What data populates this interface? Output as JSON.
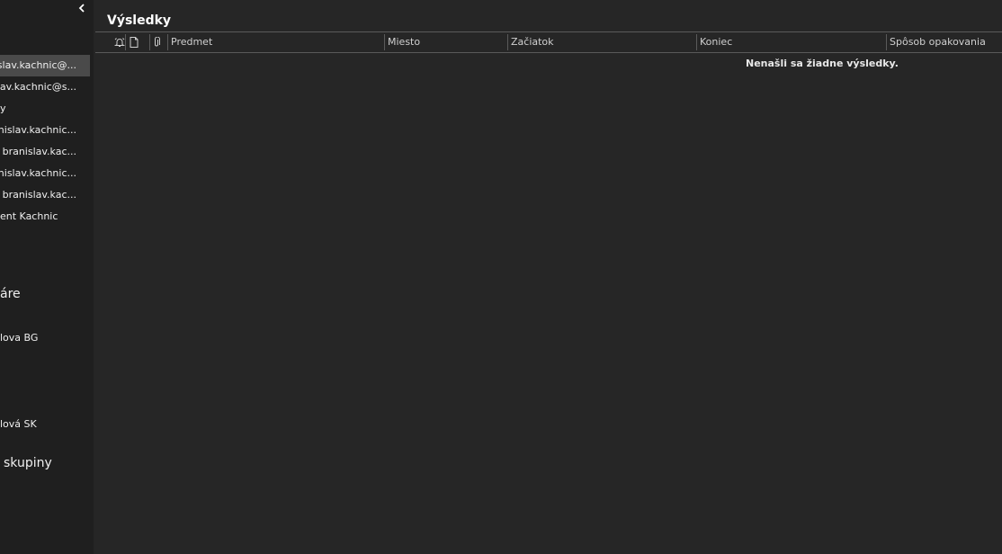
{
  "sidebar": {
    "collapse_icon": "chevron-left-icon",
    "folders": [
      {
        "label": "islav.kachnic@..."
      },
      {
        "label": "slav.kachnic@s..."
      },
      {
        "label": "y"
      },
      {
        "label": "anislav.kachnic..."
      },
      {
        "label": "- branislav.kac..."
      },
      {
        "label": "anislav.kachnic..."
      },
      {
        "label": "- branislav.kac..."
      },
      {
        "label": "ent Kachnic"
      }
    ],
    "groups": [
      {
        "label": "áre"
      },
      {
        "label": "lova BG"
      },
      {
        "label": "lová SK"
      },
      {
        "label": "skupiny"
      }
    ]
  },
  "main": {
    "title": "Výsledky",
    "columns": {
      "reminder_icon": "bell-icon",
      "item_icon": "document-icon",
      "attachment_icon": "paperclip-icon",
      "subject": "Predmet",
      "location": "Miesto",
      "start": "Začiatok",
      "end": "Koniec",
      "recurrence": "Spôsob opakovania"
    },
    "empty_message": "Nenašli sa žiadne výsledky."
  }
}
